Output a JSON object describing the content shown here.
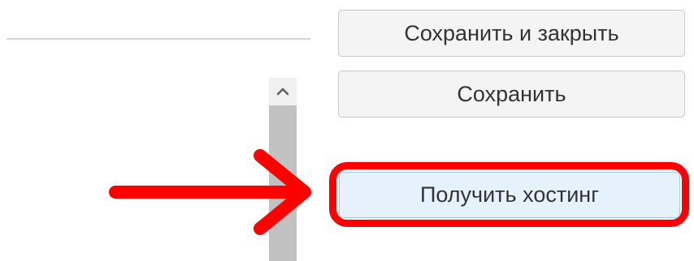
{
  "buttons": {
    "save_and_close": "Сохранить и закрыть",
    "save": "Сохранить",
    "get_hosting": "Получить хостинг"
  },
  "annotation": {
    "arrow_color": "#ff0000",
    "highlight_color": "#ff0000",
    "highlighted_button_bg": "#e5f1fb"
  },
  "icons": {
    "scroll_up": "chevron-up-icon",
    "pointer": "arrow-right-icon"
  }
}
